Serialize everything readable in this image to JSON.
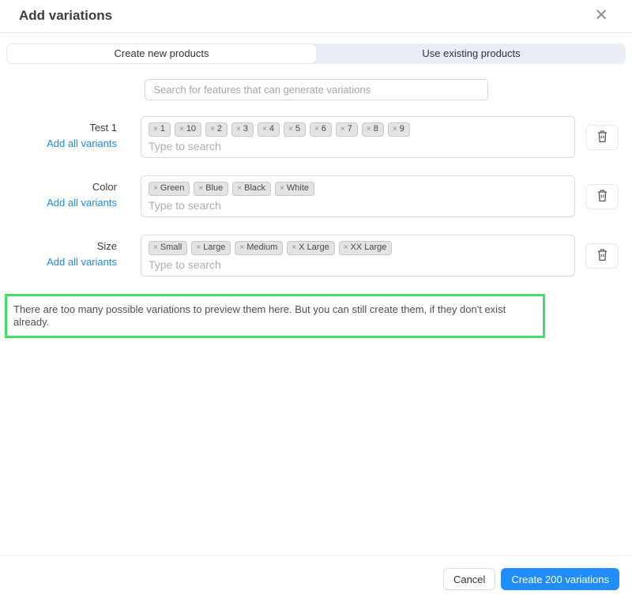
{
  "modal": {
    "title": "Add variations",
    "close_glyph": "✕"
  },
  "tabs": [
    {
      "label": "Create new products",
      "active": true
    },
    {
      "label": "Use existing products",
      "active": false
    }
  ],
  "search": {
    "placeholder": "Search for features that can generate variations"
  },
  "feature_rows": [
    {
      "label": "Test 1",
      "link": "Add all variants",
      "tags": [
        "1",
        "10",
        "2",
        "3",
        "4",
        "5",
        "6",
        "7",
        "8",
        "9"
      ],
      "input_placeholder": "Type to search"
    },
    {
      "label": "Color",
      "link": "Add all variants",
      "tags": [
        "Green",
        "Blue",
        "Black",
        "White"
      ],
      "input_placeholder": "Type to search"
    },
    {
      "label": "Size",
      "link": "Add all variants",
      "tags": [
        "Small",
        "Large",
        "Medium",
        "X Large",
        "XX Large"
      ],
      "input_placeholder": "Type to search"
    }
  ],
  "tag_remove_glyph": "×",
  "notice": {
    "text": "There are too many possible variations to preview them here. But you can still create them, if they don't exist already.",
    "border_color": "#41e169"
  },
  "footer": {
    "cancel_label": "Cancel",
    "create_label": "Create 200 variations",
    "create_color": "#1f8efa"
  },
  "theme": {
    "link_color": "#1e88e5",
    "inactive_tab_bg": "#e9edf6"
  }
}
